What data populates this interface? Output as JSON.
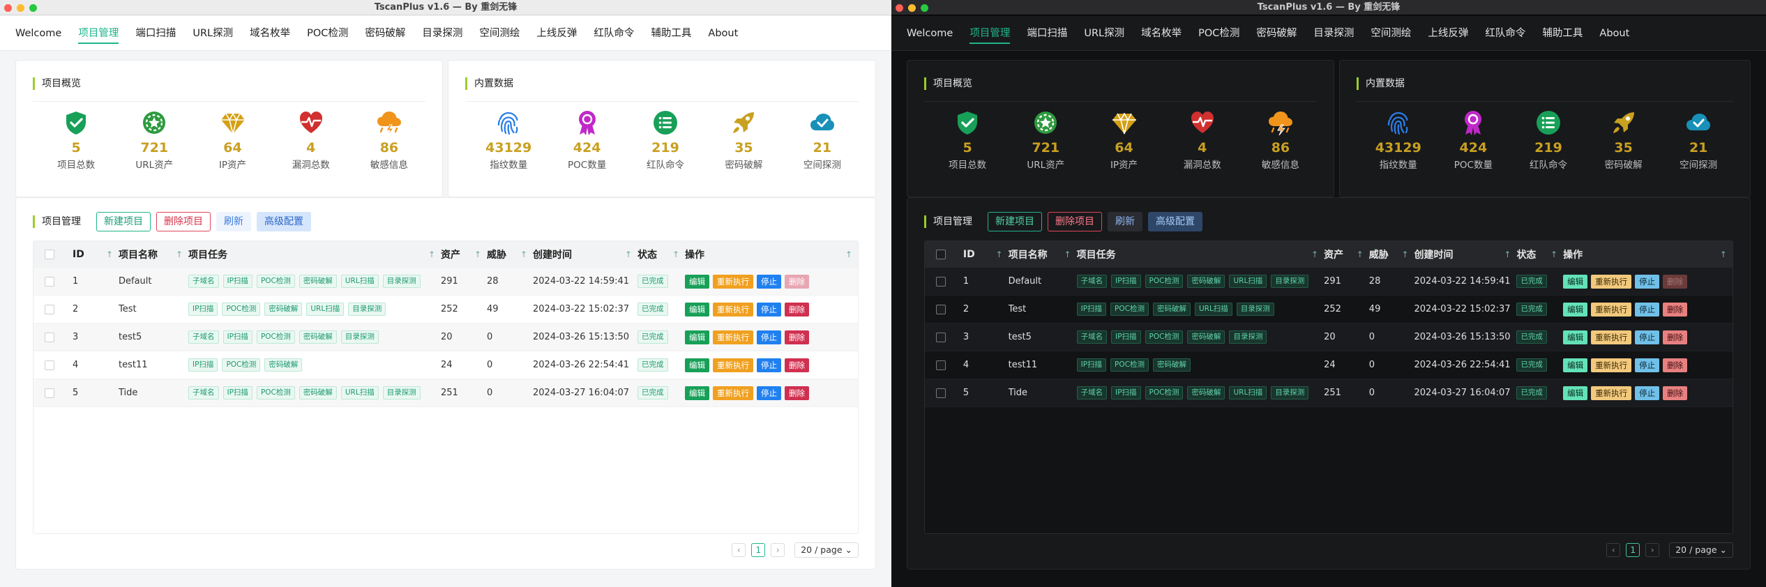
{
  "window_title": "TscanPlus v1.6 — By 重剑无锋",
  "nav_tabs": [
    "Welcome",
    "项目管理",
    "端口扫描",
    "URL探测",
    "域名枚举",
    "POC检测",
    "密码破解",
    "目录探测",
    "空间测绘",
    "上线反弹",
    "红队命令",
    "辅助工具",
    "About"
  ],
  "active_tab": "项目管理",
  "overview": {
    "title": "项目概览",
    "stats": [
      {
        "value": "5",
        "label": "项目总数",
        "icon": "shield-check-icon",
        "color": "#18a058"
      },
      {
        "value": "721",
        "label": "URL资产",
        "icon": "gear-star-icon",
        "color": "#2e9a3e"
      },
      {
        "value": "64",
        "label": "IP资产",
        "icon": "diamond-icon",
        "color": "#d4a017"
      },
      {
        "value": "4",
        "label": "漏洞总数",
        "icon": "heartbeat-icon",
        "color": "#d0302f"
      },
      {
        "value": "86",
        "label": "敏感信息",
        "icon": "storm-cloud-icon",
        "color": "#f0941c"
      }
    ]
  },
  "builtin": {
    "title": "内置数据",
    "stats": [
      {
        "value": "43129",
        "label": "指纹数量",
        "icon": "fingerprint-icon",
        "color": "#2a7ee8"
      },
      {
        "value": "424",
        "label": "POC数量",
        "icon": "award-icon",
        "color": "#c028c8"
      },
      {
        "value": "219",
        "label": "红队命令",
        "icon": "list-icon",
        "color": "#18a058"
      },
      {
        "value": "35",
        "label": "密码破解",
        "icon": "rocket-icon",
        "color": "#c9a020"
      },
      {
        "value": "21",
        "label": "空间探测",
        "icon": "cloud-check-icon",
        "color": "#1890b8"
      }
    ]
  },
  "project_mgmt": {
    "title": "项目管理",
    "buttons": {
      "new": "新建项目",
      "delete": "删除项目",
      "refresh": "刷新",
      "advanced": "高级配置"
    }
  },
  "table": {
    "headers": {
      "id": "ID",
      "name": "项目名称",
      "tasks": "项目任务",
      "assets": "资产",
      "threats": "威胁",
      "created": "创建时间",
      "status": "状态",
      "ops": "操作"
    },
    "actions": {
      "edit": "编辑",
      "rerun": "重新执行",
      "stop": "停止",
      "delete": "删除"
    },
    "rows": [
      {
        "id": "1",
        "name": "Default",
        "tasks": [
          "子域名",
          "IP扫描",
          "POC检测",
          "密码破解",
          "URL扫描",
          "目录探测"
        ],
        "assets": "291",
        "threats": "28",
        "created": "2024-03-22 14:59:41",
        "status": "已完成",
        "delete_disabled": true
      },
      {
        "id": "2",
        "name": "Test",
        "tasks": [
          "IP扫描",
          "POC检测",
          "密码破解",
          "URL扫描",
          "目录探测"
        ],
        "assets": "252",
        "threats": "49",
        "created": "2024-03-22 15:02:37",
        "status": "已完成",
        "delete_disabled": false
      },
      {
        "id": "3",
        "name": "test5",
        "tasks": [
          "子域名",
          "IP扫描",
          "POC检测",
          "密码破解",
          "目录探测"
        ],
        "assets": "20",
        "threats": "0",
        "created": "2024-03-26 15:13:50",
        "status": "已完成",
        "delete_disabled": false
      },
      {
        "id": "4",
        "name": "test11",
        "tasks": [
          "IP扫描",
          "POC检测",
          "密码破解"
        ],
        "assets": "24",
        "threats": "0",
        "created": "2024-03-26 22:54:41",
        "status": "已完成",
        "delete_disabled": false
      },
      {
        "id": "5",
        "name": "Tide",
        "tasks": [
          "子域名",
          "IP扫描",
          "POC检测",
          "密码破解",
          "URL扫描",
          "目录探测"
        ],
        "assets": "251",
        "threats": "0",
        "created": "2024-03-27 16:04:07",
        "status": "已完成",
        "delete_disabled": false
      }
    ]
  },
  "pagination": {
    "prev": "‹",
    "current": "1",
    "next": "›",
    "page_size": "20 / page"
  },
  "theme_variants": [
    "light",
    "dark"
  ]
}
